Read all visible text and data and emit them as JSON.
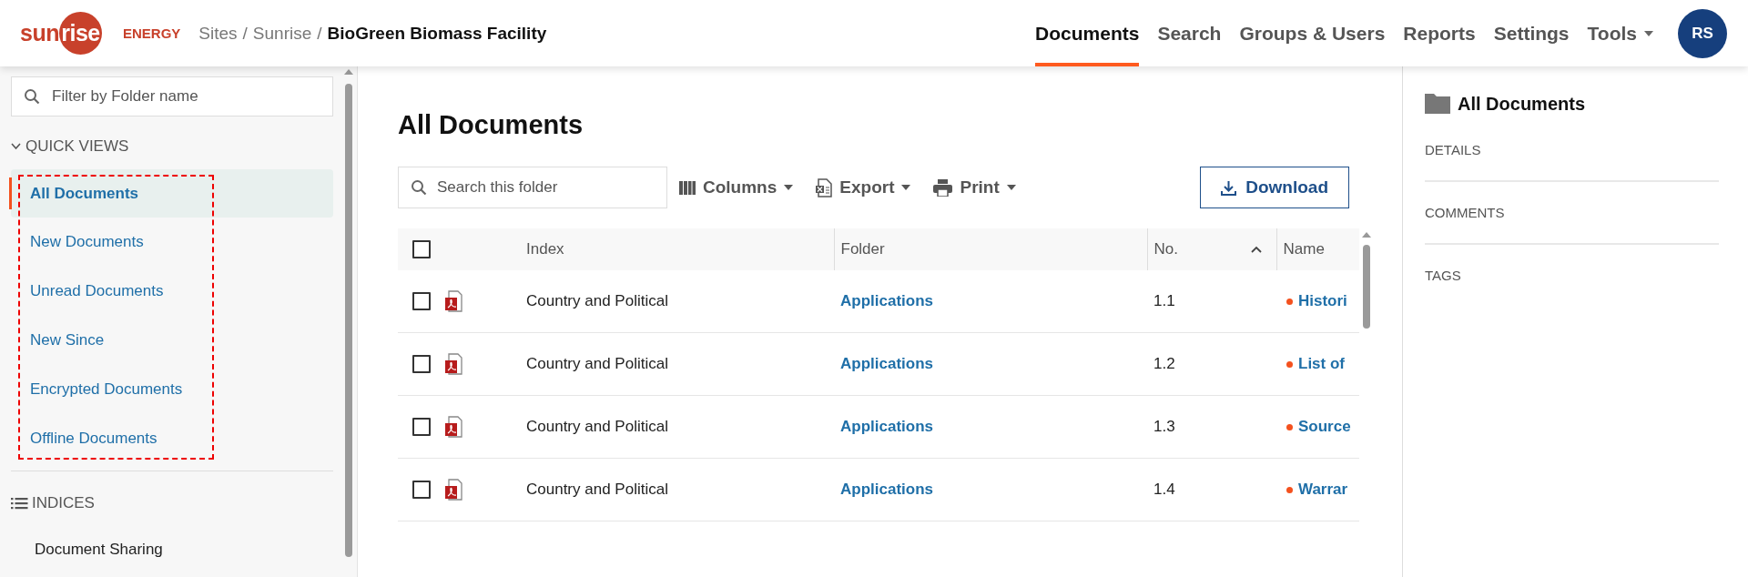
{
  "header": {
    "logo": {
      "wordmark_plain": "sun",
      "wordmark_circle": "rise",
      "tagline": "ENERGY"
    },
    "breadcrumb": {
      "items": [
        "Sites",
        "Sunrise"
      ],
      "separators": [
        "/",
        "/"
      ],
      "current": "BioGreen Biomass Facility"
    },
    "nav": [
      {
        "label": "Documents",
        "selected": true,
        "dropdown": false
      },
      {
        "label": "Search",
        "selected": false,
        "dropdown": false
      },
      {
        "label": "Groups & Users",
        "selected": false,
        "dropdown": false
      },
      {
        "label": "Reports",
        "selected": false,
        "dropdown": false
      },
      {
        "label": "Settings",
        "selected": false,
        "dropdown": false
      },
      {
        "label": "Tools",
        "selected": false,
        "dropdown": true
      }
    ],
    "avatar": {
      "initials": "RS"
    }
  },
  "sidebar": {
    "filter": {
      "placeholder": "Filter by Folder name"
    },
    "quick_views": {
      "title": "QUICK VIEWS",
      "expanded": true,
      "highlighted": true,
      "items": [
        {
          "label": "All Documents",
          "selected": true
        },
        {
          "label": "New Documents",
          "selected": false
        },
        {
          "label": "Unread Documents",
          "selected": false
        },
        {
          "label": "New Since",
          "selected": false
        },
        {
          "label": "Encrypted Documents",
          "selected": false
        },
        {
          "label": "Offline Documents",
          "selected": false
        }
      ]
    },
    "indices": {
      "title": "INDICES",
      "items": [
        {
          "label": "Document Sharing"
        }
      ]
    }
  },
  "main": {
    "title": "All Documents",
    "search": {
      "placeholder": "Search this folder"
    },
    "toolbar": [
      {
        "label": "Columns",
        "kind": "columns"
      },
      {
        "label": "Export",
        "kind": "export"
      },
      {
        "label": "Print",
        "kind": "print"
      }
    ],
    "download": {
      "label": "Download"
    },
    "table": {
      "select_all": {
        "checked": false
      },
      "columns": [
        {
          "label": "Index",
          "sorted": false
        },
        {
          "label": "Folder",
          "sorted": false
        },
        {
          "label": "No.",
          "sorted": true
        },
        {
          "label": "Name",
          "sorted": false
        }
      ],
      "rows": [
        {
          "checked": false,
          "kind": "pdf",
          "index": "Country and Political",
          "folder": "Applications",
          "no": "1.1",
          "name": "Histori",
          "color": "#f4511e"
        },
        {
          "checked": false,
          "kind": "pdf",
          "index": "Country and Political",
          "folder": "Applications",
          "no": "1.2",
          "name": "List of",
          "color": "#f4511e"
        },
        {
          "checked": false,
          "kind": "pdf",
          "index": "Country and Political",
          "folder": "Applications",
          "no": "1.3",
          "name": "Source",
          "color": "#f4511e"
        },
        {
          "checked": false,
          "kind": "pdf",
          "index": "Country and Political",
          "folder": "Applications",
          "no": "1.4",
          "name": "Warrar",
          "color": "#f4511e"
        }
      ]
    }
  },
  "details_panel": {
    "title": "All Documents",
    "sections": [
      "DETAILS",
      "COMMENTS",
      "TAGS"
    ]
  }
}
